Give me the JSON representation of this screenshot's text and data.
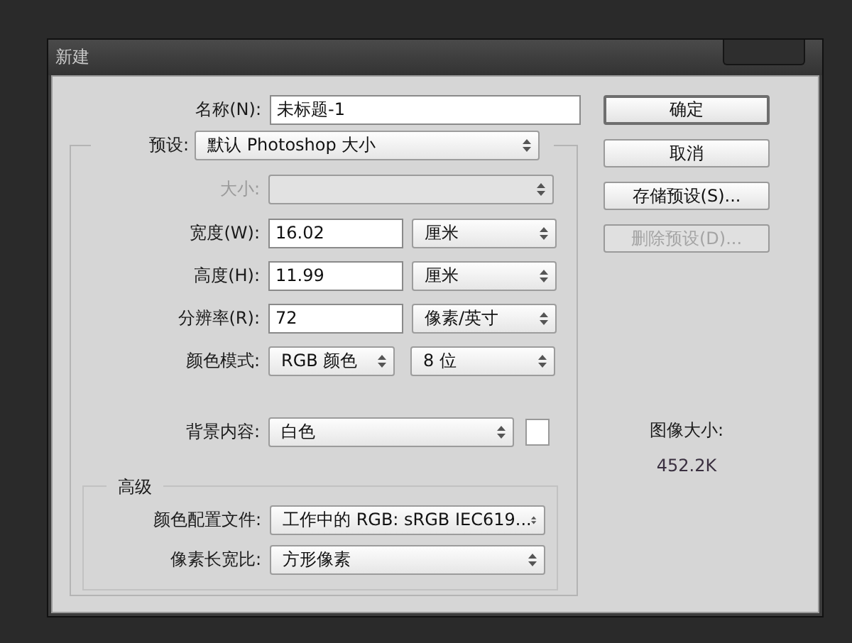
{
  "window": {
    "title": "新建"
  },
  "name_field": {
    "label": "名称(N):",
    "value": "未标题-1"
  },
  "preset": {
    "label": "预设:",
    "value": "默认 Photoshop 大小"
  },
  "fields": [
    {
      "kind": "select",
      "label": "大小:",
      "disabled": true
    },
    {
      "kind": "input_unit",
      "label": "宽度(W):",
      "value": "16.02",
      "unit": "厘米",
      "disabled": false
    },
    {
      "kind": "input_unit",
      "label": "高度(H):",
      "value": "11.99",
      "unit": "厘米",
      "disabled": false
    },
    {
      "kind": "input_unit",
      "label": "分辨率(R):",
      "value": "72",
      "unit": "像素/英寸",
      "disabled": false
    },
    {
      "kind": "two_select",
      "label": "颜色模式:",
      "value": "RGB 颜色",
      "unit": "8 位",
      "disabled": false
    },
    {
      "kind": "select_swatch",
      "label": "背景内容:",
      "value": "白色",
      "color": "#ffffff",
      "disabled": false
    }
  ],
  "advanced": {
    "title": "高级",
    "fields": [
      {
        "label": "颜色配置文件:",
        "value": "工作中的 RGB: sRGB IEC619..."
      },
      {
        "label": "像素长宽比:",
        "value": "方形像素"
      }
    ]
  },
  "buttons": [
    {
      "label": "确定",
      "default": true,
      "disabled": false
    },
    {
      "label": "取消",
      "default": false,
      "disabled": false
    },
    {
      "label": "存储预设(S)...",
      "default": false,
      "disabled": false
    },
    {
      "label": "删除预设(D)...",
      "default": false,
      "disabled": true
    }
  ],
  "image_size": {
    "label": "图像大小:",
    "value": "452.2K"
  }
}
